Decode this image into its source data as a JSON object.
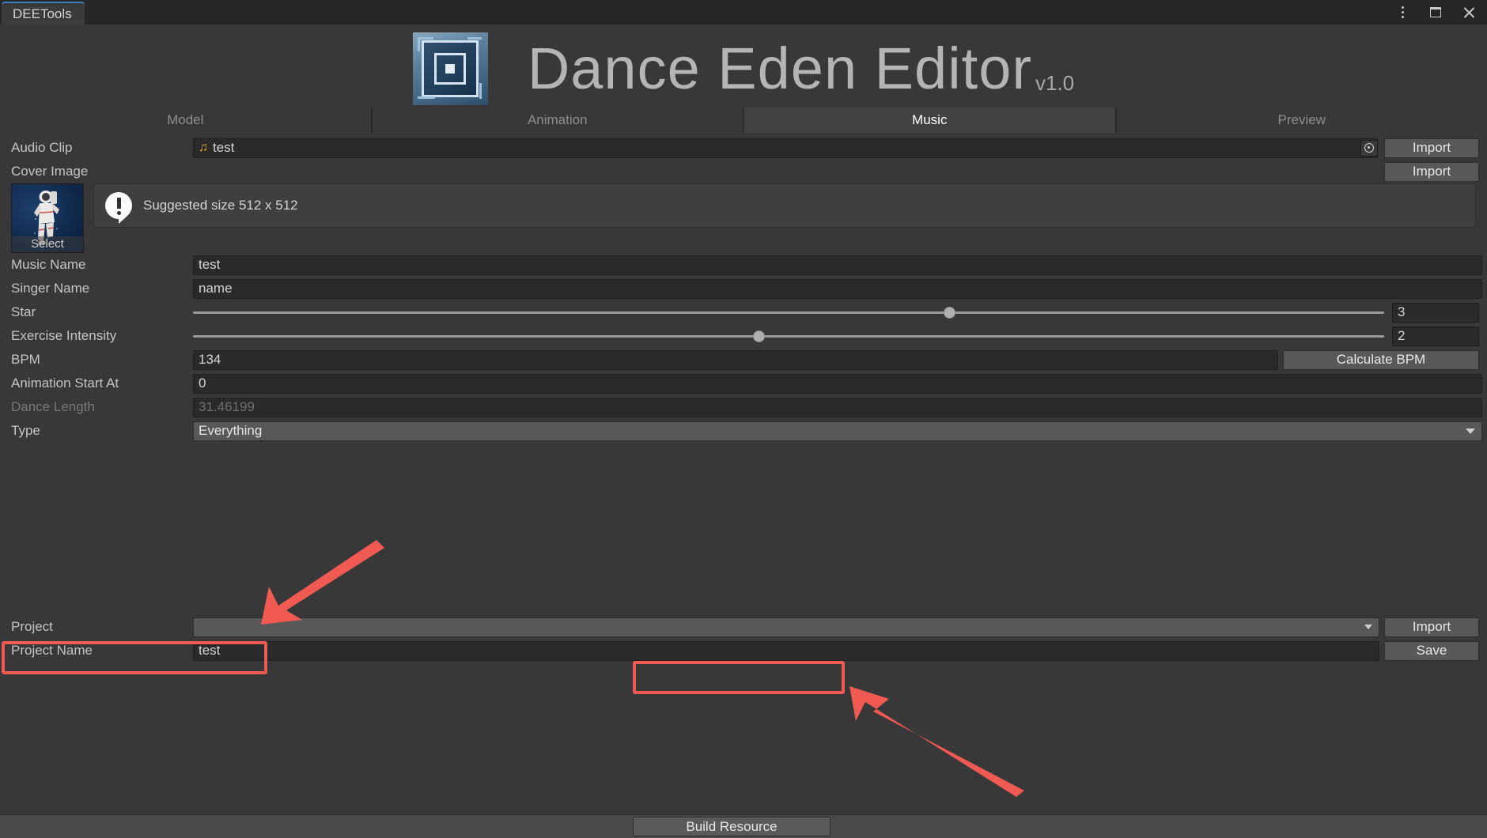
{
  "window": {
    "tab_title": "DEETools",
    "controls": {
      "menu": "more-options",
      "maximize": "maximize",
      "close": "close"
    }
  },
  "header": {
    "title": "Dance Eden Editor",
    "version": "v1.0",
    "logo_alt": "app-logo"
  },
  "tabs": [
    {
      "label": "Model",
      "active": false
    },
    {
      "label": "Animation",
      "active": false
    },
    {
      "label": "Music",
      "active": true
    },
    {
      "label": "Preview",
      "active": false
    }
  ],
  "form": {
    "audio_clip": {
      "label": "Audio Clip",
      "value": "test",
      "icon": "music-note-icon",
      "import_label": "Import"
    },
    "cover_image": {
      "label": "Cover Image",
      "import_label": "Import",
      "thumb_overlay": "Select",
      "info_text": "Suggested size 512 x 512",
      "info_icon": "warning-exclamation-icon"
    },
    "music_name": {
      "label": "Music Name",
      "value": "test"
    },
    "singer_name": {
      "label": "Singer Name",
      "value": "name"
    },
    "star": {
      "label": "Star",
      "value": "3",
      "percent": 63
    },
    "exercise_intensity": {
      "label": "Exercise Intensity",
      "value": "2",
      "percent": 47
    },
    "bpm": {
      "label": "BPM",
      "value": "134",
      "button_label": "Calculate BPM"
    },
    "animation_start_at": {
      "label": "Animation Start At",
      "value": "0"
    },
    "dance_length": {
      "label": "Dance Length",
      "value": "31.46199",
      "disabled": true
    },
    "type": {
      "label": "Type",
      "value": "Everything"
    }
  },
  "bottom": {
    "project": {
      "label": "Project",
      "value": "",
      "import_label": "Import"
    },
    "project_name": {
      "label": "Project Name",
      "value": "test",
      "save_label": "Save"
    },
    "build_resource_label": "Build Resource"
  },
  "annotations": {
    "arrow_color": "#f05a52",
    "highlight_color": "#f05a52",
    "arrow_1_target": "project-field",
    "arrow_2_target": "build-resource-button",
    "highlight_1_target": "project-name-row",
    "highlight_2_target": "build-resource-button"
  }
}
